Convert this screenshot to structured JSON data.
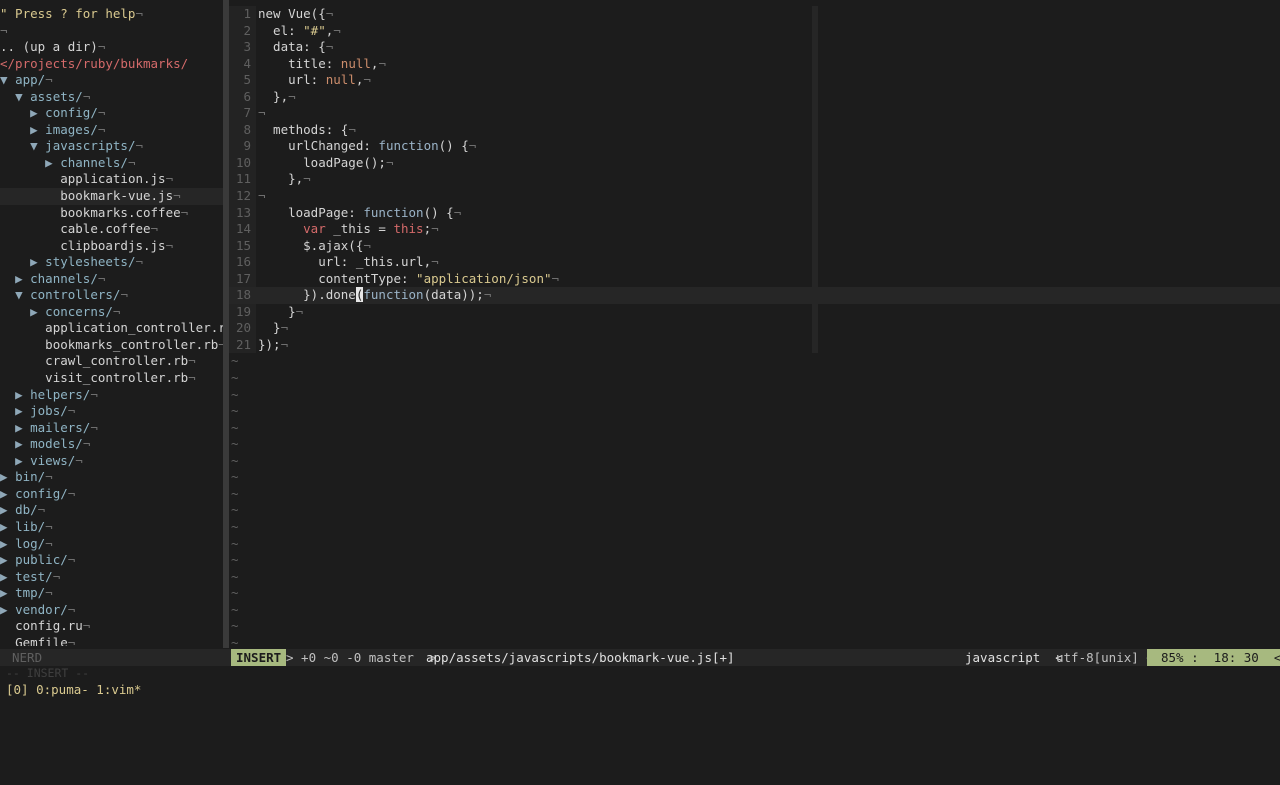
{
  "nerdtree": {
    "help": "\" Press ? for help",
    "up": ".. (up a dir)",
    "root": "</projects/ruby/bukmarks/",
    "nodes": [
      {
        "indent": 0,
        "arrow": "▼ ",
        "name": "app/",
        "dir": true
      },
      {
        "indent": 1,
        "arrow": "▼ ",
        "name": "assets/",
        "dir": true
      },
      {
        "indent": 2,
        "arrow": "▶ ",
        "name": "config/",
        "dir": true
      },
      {
        "indent": 2,
        "arrow": "▶ ",
        "name": "images/",
        "dir": true
      },
      {
        "indent": 2,
        "arrow": "▼ ",
        "name": "javascripts/",
        "dir": true
      },
      {
        "indent": 3,
        "arrow": "▶ ",
        "name": "channels/",
        "dir": true
      },
      {
        "indent": 3,
        "arrow": "  ",
        "name": "application.js",
        "dir": false
      },
      {
        "indent": 3,
        "arrow": "  ",
        "name": "bookmark-vue.js",
        "dir": false,
        "selected": true
      },
      {
        "indent": 3,
        "arrow": "  ",
        "name": "bookmarks.coffee",
        "dir": false
      },
      {
        "indent": 3,
        "arrow": "  ",
        "name": "cable.coffee",
        "dir": false
      },
      {
        "indent": 3,
        "arrow": "  ",
        "name": "clipboardjs.js",
        "dir": false
      },
      {
        "indent": 2,
        "arrow": "▶ ",
        "name": "stylesheets/",
        "dir": true
      },
      {
        "indent": 1,
        "arrow": "▶ ",
        "name": "channels/",
        "dir": true
      },
      {
        "indent": 1,
        "arrow": "▼ ",
        "name": "controllers/",
        "dir": true
      },
      {
        "indent": 2,
        "arrow": "▶ ",
        "name": "concerns/",
        "dir": true
      },
      {
        "indent": 2,
        "arrow": "  ",
        "name": "application_controller.rb",
        "dir": false
      },
      {
        "indent": 2,
        "arrow": "  ",
        "name": "bookmarks_controller.rb",
        "dir": false
      },
      {
        "indent": 2,
        "arrow": "  ",
        "name": "crawl_controller.rb",
        "dir": false
      },
      {
        "indent": 2,
        "arrow": "  ",
        "name": "visit_controller.rb",
        "dir": false
      },
      {
        "indent": 1,
        "arrow": "▶ ",
        "name": "helpers/",
        "dir": true
      },
      {
        "indent": 1,
        "arrow": "▶ ",
        "name": "jobs/",
        "dir": true
      },
      {
        "indent": 1,
        "arrow": "▶ ",
        "name": "mailers/",
        "dir": true
      },
      {
        "indent": 1,
        "arrow": "▶ ",
        "name": "models/",
        "dir": true
      },
      {
        "indent": 1,
        "arrow": "▶ ",
        "name": "views/",
        "dir": true
      },
      {
        "indent": 0,
        "arrow": "▶ ",
        "name": "bin/",
        "dir": true
      },
      {
        "indent": 0,
        "arrow": "▶ ",
        "name": "config/",
        "dir": true
      },
      {
        "indent": 0,
        "arrow": "▶ ",
        "name": "db/",
        "dir": true
      },
      {
        "indent": 0,
        "arrow": "▶ ",
        "name": "lib/",
        "dir": true
      },
      {
        "indent": 0,
        "arrow": "▶ ",
        "name": "log/",
        "dir": true
      },
      {
        "indent": 0,
        "arrow": "▶ ",
        "name": "public/",
        "dir": true
      },
      {
        "indent": 0,
        "arrow": "▶ ",
        "name": "test/",
        "dir": true
      },
      {
        "indent": 0,
        "arrow": "▶ ",
        "name": "tmp/",
        "dir": true
      },
      {
        "indent": 0,
        "arrow": "▶ ",
        "name": "vendor/",
        "dir": true
      },
      {
        "indent": 0,
        "arrow": "  ",
        "name": "config.ru",
        "dir": false
      },
      {
        "indent": 0,
        "arrow": "  ",
        "name": "Gemfile",
        "dir": false
      }
    ],
    "eol": "¬"
  },
  "editor": {
    "lines": [
      [
        {
          "t": "new Vue({"
        }
      ],
      [
        {
          "t": "  el: "
        },
        {
          "t": "\"#\"",
          "c": "str"
        },
        {
          "t": ","
        }
      ],
      [
        {
          "t": "  data: {"
        }
      ],
      [
        {
          "t": "    title: "
        },
        {
          "t": "null",
          "c": "null"
        },
        {
          "t": ","
        }
      ],
      [
        {
          "t": "    url: "
        },
        {
          "t": "null",
          "c": "null"
        },
        {
          "t": ","
        }
      ],
      [
        {
          "t": "  },"
        }
      ],
      [],
      [
        {
          "t": "  methods: {"
        }
      ],
      [
        {
          "t": "    urlChanged: "
        },
        {
          "t": "function",
          "c": "fn"
        },
        {
          "t": "() {"
        }
      ],
      [
        {
          "t": "      loadPage();"
        }
      ],
      [
        {
          "t": "    },"
        }
      ],
      [],
      [
        {
          "t": "    loadPage: "
        },
        {
          "t": "function",
          "c": "fn"
        },
        {
          "t": "() {"
        }
      ],
      [
        {
          "t": "      "
        },
        {
          "t": "var",
          "c": "var"
        },
        {
          "t": " _this = "
        },
        {
          "t": "this",
          "c": "this"
        },
        {
          "t": ";"
        }
      ],
      [
        {
          "t": "      $.ajax({"
        }
      ],
      [
        {
          "t": "        url: _this.url,"
        }
      ],
      [
        {
          "t": "        contentType: "
        },
        {
          "t": "\"application/json\"",
          "c": "str"
        }
      ],
      [
        {
          "t": "      }).done"
        },
        {
          "t": "(",
          "c": "cursor"
        },
        {
          "t": "function",
          "c": "fn"
        },
        {
          "t": "(data));"
        }
      ],
      [
        {
          "t": "    }"
        }
      ],
      [
        {
          "t": "  }"
        }
      ],
      [
        {
          "t": "});"
        }
      ]
    ],
    "current_line": 18,
    "tilde_count": 18,
    "tilde": "~"
  },
  "statusline": {
    "nerd": "NERD",
    "mode": "INSERT",
    "git": "> +0 ~0 -0 master  >",
    "file": "app/assets/javascripts/bookmark-vue.js[+]",
    "filetype": "javascript  <",
    "encoding": "utf-8[unix] <",
    "position": "85% :  18: 30  <"
  },
  "cmdline": "-- INSERT --",
  "tmux": "[0] 0:puma- 1:vim*"
}
